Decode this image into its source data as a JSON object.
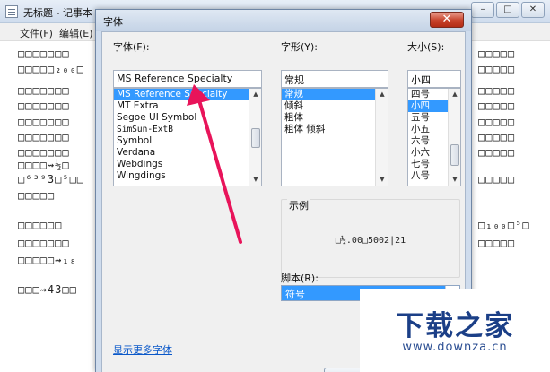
{
  "notepad": {
    "title": "无标题 - 记事本",
    "window_buttons": [
      "–",
      "□",
      "✕"
    ],
    "menu": [
      "文件(F)",
      "编辑(E)"
    ],
    "left_lines": [
      "□□□□□□□",
      "□□□□□₂₀₀□",
      "□□□□□□□",
      "□□□□□□□",
      "□□□□□□□",
      "□□□□□□□",
      "□□□□□□□",
      "□□□□⇝½□",
      "□⁶³⁹3□⁵□□",
      "□□□□□",
      "□□□□□□",
      "□□□□□□□",
      "□□□□□⇝₁₈",
      "□□□⇝43□□"
    ],
    "right_lines": [
      "□□□□□",
      "□□□□□",
      "□□□□□",
      "□□□□□",
      "□□□□□",
      "□□□□□",
      "□□□□□",
      "□□□□□",
      "□₁₀₀□⁵□",
      "□□□□□"
    ]
  },
  "dialog": {
    "title": "字体",
    "close_label": "✕",
    "font_label": "字体(F):",
    "font_value": "MS Reference Specialty",
    "font_list": [
      "MS Reference Specialty",
      "MT Extra",
      "Segoe UI Symbol",
      "SimSun-ExtB",
      "Symbol",
      "Verdana",
      "Webdings",
      "Wingdings"
    ],
    "style_label": "字形(Y):",
    "style_value": "常规",
    "style_list": [
      "常规",
      "倾斜",
      "粗体",
      "粗体 倾斜"
    ],
    "size_label": "大小(S):",
    "size_value": "小四",
    "size_list": [
      "四号",
      "小四",
      "五号",
      "小五",
      "六号",
      "小六",
      "七号",
      "八号"
    ],
    "sample_label": "示例",
    "sample_text": "□½.00□5002|21",
    "script_label": "脚本(R):",
    "script_value": "符号",
    "more_fonts_link": "显示更多字体"
  },
  "watermark": {
    "title": "下载之家",
    "url": "www.downza.cn"
  },
  "colors": {
    "selection": "#3399ff",
    "arrow": "#e8145a",
    "watermark_text": "#1b3f87"
  }
}
